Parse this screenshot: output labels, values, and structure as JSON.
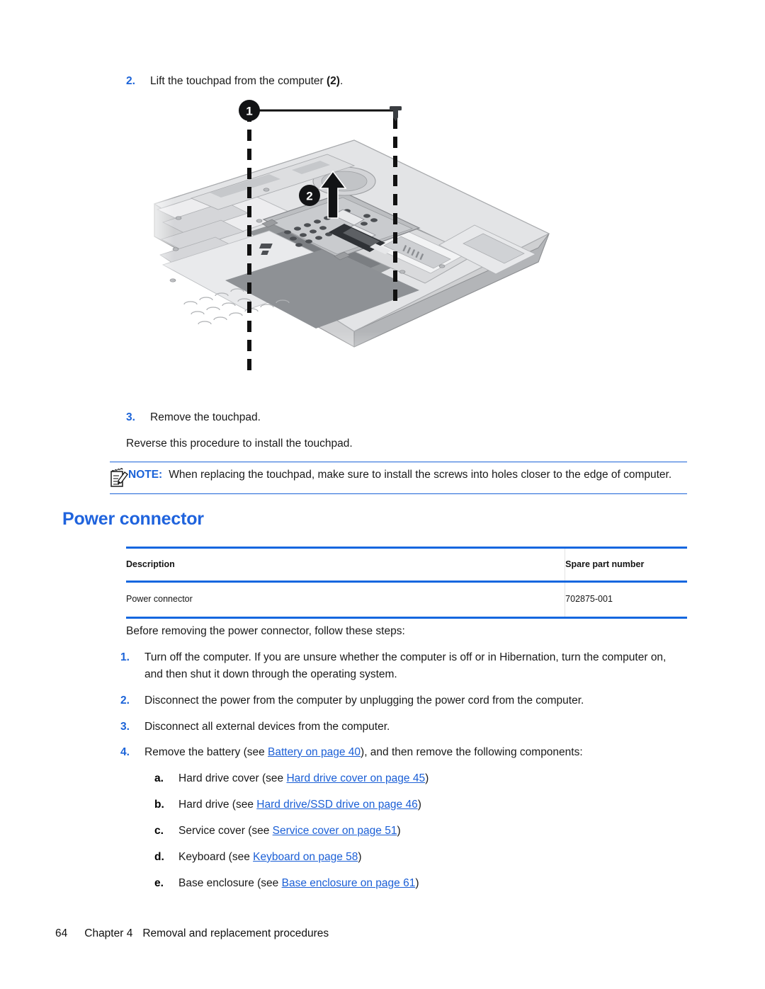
{
  "page": {
    "number": "64",
    "chapter": "Chapter 4",
    "chapter_title": "Removal and replacement procedures"
  },
  "steps_top": [
    {
      "num": "2.",
      "text_before": "Lift the touchpad from the computer ",
      "bold": "(2)",
      "text_after": "."
    },
    {
      "num": "3.",
      "text_before": "Remove the touchpad.",
      "bold": "",
      "text_after": ""
    }
  ],
  "reverse_note": "Reverse this procedure to install the touchpad.",
  "note": {
    "icon": "note-pad-pencil-icon",
    "label": "NOTE:",
    "text": "When replacing the touchpad, make sure to install the screws into holes closer to the edge of computer.",
    "rule_color": "#1b63d8"
  },
  "figure": {
    "name": "touchpad-removal-illustration",
    "callouts": [
      {
        "id": "1",
        "meaning": "touchpad screws"
      },
      {
        "id": "2",
        "meaning": "lift touchpad"
      }
    ],
    "caption": ""
  },
  "section": {
    "heading": "Power connector",
    "heading_color": "#1f63dd"
  },
  "parts_table": {
    "columns": [
      "Description",
      "Spare part number"
    ],
    "rows": [
      [
        "Power connector",
        "702875-001"
      ]
    ],
    "rule_color": "#1467df"
  },
  "intro": "Before removing the power connector, follow these steps:",
  "procedure": [
    {
      "num": "1.",
      "parts": [
        {
          "type": "text",
          "value": "Turn off the computer. If you are unsure whether the computer is off or in Hibernation, turn the computer on, and then shut it down through the operating system."
        }
      ]
    },
    {
      "num": "2.",
      "parts": [
        {
          "type": "text",
          "value": "Disconnect the power from the computer by unplugging the power cord from the computer."
        }
      ]
    },
    {
      "num": "3.",
      "parts": [
        {
          "type": "text",
          "value": "Disconnect all external devices from the computer."
        }
      ]
    },
    {
      "num": "4.",
      "parts": [
        {
          "type": "text",
          "value": "Remove the battery (see "
        },
        {
          "type": "link",
          "value": "Battery on page 40"
        },
        {
          "type": "text",
          "value": "), and then remove the following components:"
        }
      ]
    }
  ],
  "sub_procedure": [
    {
      "letter": "a.",
      "before": "Hard drive cover (see ",
      "link": "Hard drive cover on page 45",
      "after": ")"
    },
    {
      "letter": "b.",
      "before": "Hard drive (see ",
      "link": "Hard drive/SSD drive on page 46",
      "after": ")"
    },
    {
      "letter": "c.",
      "before": "Service cover (see ",
      "link": "Service cover on page 51",
      "after": ")"
    },
    {
      "letter": "d.",
      "before": "Keyboard (see ",
      "link": "Keyboard on page 58",
      "after": ")"
    },
    {
      "letter": "e.",
      "before": "Base enclosure (see ",
      "link": "Base enclosure on page 61",
      "after": ")"
    }
  ],
  "colors": {
    "link": "#1b5fd6",
    "accent_blue": "#1b63d8",
    "rule_blue": "#1467df"
  }
}
